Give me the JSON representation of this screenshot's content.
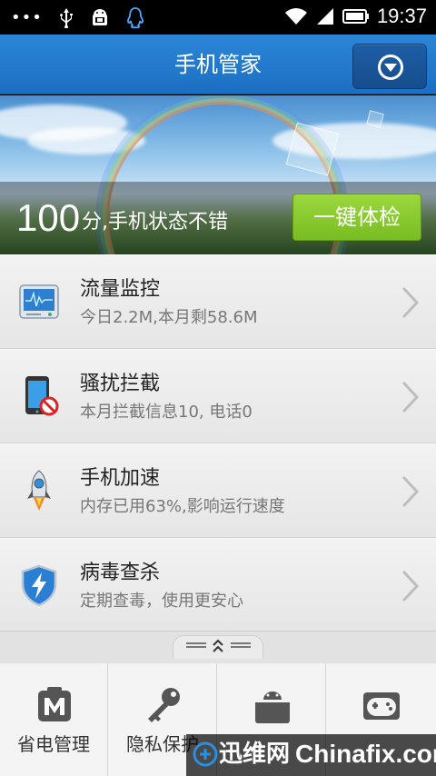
{
  "status_bar": {
    "dots": "•••",
    "time": "19:37",
    "icons": [
      "usb-icon",
      "android-debug-icon",
      "qq-icon",
      "wifi-icon",
      "signal-icon",
      "battery-icon"
    ]
  },
  "header": {
    "title": "手机管家",
    "menu_icon": "dropdown-circle-icon"
  },
  "banner": {
    "score": "100",
    "score_text": "分,手机状态不错",
    "check_button": "一键体检"
  },
  "list": [
    {
      "title": "流量监控",
      "subtitle": "今日2.2M,本月剩58.6M",
      "icon": "traffic-monitor-icon"
    },
    {
      "title": "骚扰拦截",
      "subtitle": "本月拦截信息10, 电话0",
      "icon": "block-harassment-icon"
    },
    {
      "title": "手机加速",
      "subtitle": "内存已用63%,影响运行速度",
      "icon": "rocket-icon"
    },
    {
      "title": "病毒查杀",
      "subtitle": "定期查毒，使用更安心",
      "icon": "shield-icon"
    }
  ],
  "tabs": [
    {
      "label": "省电管理",
      "icon": "battery-m-icon"
    },
    {
      "label": "隐私保护",
      "icon": "key-icon"
    },
    {
      "label": "",
      "icon": "android-box-icon"
    },
    {
      "label": "",
      "icon": "gamepad-icon"
    }
  ],
  "watermark": {
    "cn": "迅维网",
    "en": "Chinafix.com"
  },
  "colors": {
    "header_blue": "#2177cd",
    "check_green": "#86c82c",
    "status_bar": "#000000"
  }
}
